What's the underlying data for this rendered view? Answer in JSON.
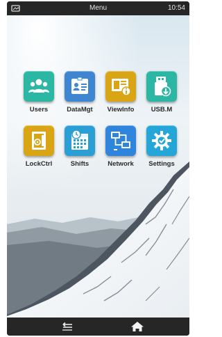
{
  "status_bar": {
    "title": "Menu",
    "time": "10:54"
  },
  "apps": [
    {
      "label": "Users",
      "icon": "users-icon",
      "color": "#2bb7a3"
    },
    {
      "label": "DataMgt",
      "icon": "id-card-icon",
      "color": "#3f86d2"
    },
    {
      "label": "ViewInfo",
      "icon": "info-monitor-icon",
      "color": "#d9a514"
    },
    {
      "label": "USB.M",
      "icon": "usb-drive-icon",
      "color": "#2bb7a3"
    },
    {
      "label": "LockCtrl",
      "icon": "lock-door-icon",
      "color": "#d9a514"
    },
    {
      "label": "Shifts",
      "icon": "calendar-clock-icon",
      "color": "#2a9fd6"
    },
    {
      "label": "Network",
      "icon": "network-icon",
      "color": "#2f84dc"
    },
    {
      "label": "Settings",
      "icon": "gear-icon",
      "color": "#24a6d8"
    }
  ],
  "nav_bar": {
    "back_icon": "back-arrow-icon",
    "home_icon": "home-icon"
  }
}
